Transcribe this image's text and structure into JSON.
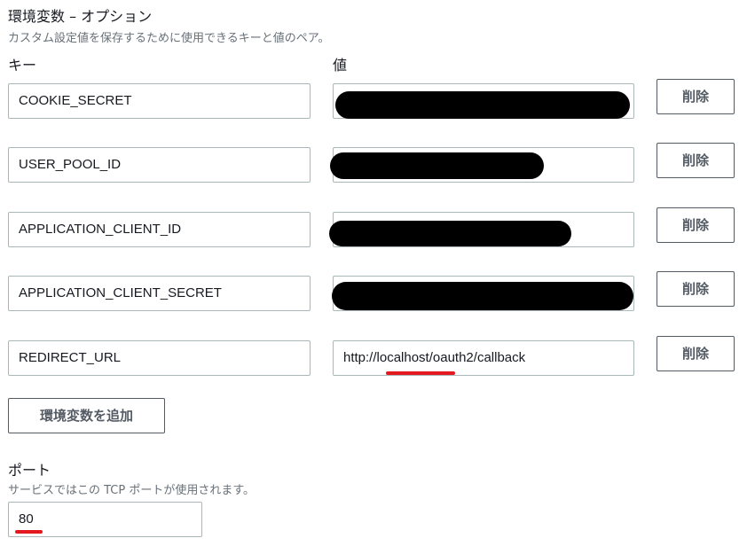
{
  "section": {
    "title": "環境変数 – オプション",
    "description": "カスタム設定値を保存するために使用できるキーと値のペア。",
    "key_header": "キー",
    "value_header": "値"
  },
  "env_vars": [
    {
      "key": "COOKIE_SECRET",
      "value": "",
      "redacted": true
    },
    {
      "key": "USER_POOL_ID",
      "value": "",
      "redacted": true
    },
    {
      "key": "APPLICATION_CLIENT_ID",
      "value": "",
      "redacted": true
    },
    {
      "key": "APPLICATION_CLIENT_SECRET",
      "value": "",
      "redacted": true
    },
    {
      "key": "REDIRECT_URL",
      "value": "http://localhost/oauth2/callback",
      "redacted": false
    }
  ],
  "delete_label": "削除",
  "add_button": "環境変数を追加",
  "port": {
    "label": "ポート",
    "description": "サービスではこの TCP ポートが使用されます。",
    "value": "80"
  },
  "colors": {
    "annotation": "#e3191f",
    "redaction": "#000000"
  }
}
